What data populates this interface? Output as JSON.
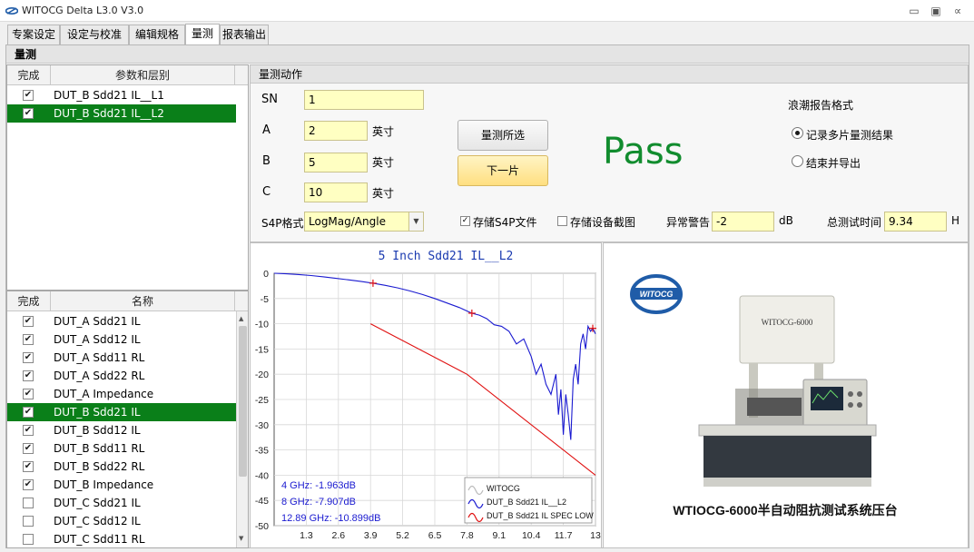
{
  "window": {
    "title": "WITOCG Delta L3.0 V3.0"
  },
  "tabs": [
    {
      "label": "专案设定"
    },
    {
      "label": "设定与校准"
    },
    {
      "label": "编辑规格"
    },
    {
      "label": "量测"
    },
    {
      "label": "报表输出"
    }
  ],
  "section_title": "量测",
  "layer_grid": {
    "headers": {
      "done": "完成",
      "param": "参数和层别"
    },
    "rows": [
      {
        "label": "DUT_B Sdd21 IL__L1",
        "checked": true,
        "selected": false
      },
      {
        "label": "DUT_B Sdd21 IL__L2",
        "checked": true,
        "selected": true
      }
    ]
  },
  "name_grid": {
    "headers": {
      "done": "完成",
      "name": "名称"
    },
    "rows": [
      {
        "label": "DUT_A Sdd21 IL",
        "checked": true,
        "selected": false
      },
      {
        "label": "DUT_A Sdd12 IL",
        "checked": true,
        "selected": false
      },
      {
        "label": "DUT_A Sdd11 RL",
        "checked": true,
        "selected": false
      },
      {
        "label": "DUT_A Sdd22 RL",
        "checked": true,
        "selected": false
      },
      {
        "label": "DUT_A Impedance",
        "checked": true,
        "selected": false
      },
      {
        "label": "DUT_B Sdd21 IL",
        "checked": true,
        "selected": true
      },
      {
        "label": "DUT_B Sdd12 IL",
        "checked": true,
        "selected": false
      },
      {
        "label": "DUT_B Sdd11 RL",
        "checked": true,
        "selected": false
      },
      {
        "label": "DUT_B Sdd22 RL",
        "checked": true,
        "selected": false
      },
      {
        "label": "DUT_B Impedance",
        "checked": true,
        "selected": false
      },
      {
        "label": "DUT_C Sdd21 IL",
        "checked": false,
        "selected": false
      },
      {
        "label": "DUT_C Sdd12 IL",
        "checked": false,
        "selected": false
      },
      {
        "label": "DUT_C Sdd11 RL",
        "checked": false,
        "selected": false
      }
    ]
  },
  "measure": {
    "title": "量测动作",
    "sn_label": "SN",
    "sn_value": "1",
    "a_label": "A",
    "a_value": "2",
    "b_label": "B",
    "b_value": "5",
    "c_label": "C",
    "c_value": "10",
    "unit_inch": "英寸",
    "s4p_format_label": "S4P格式",
    "s4p_format_value": "LogMag/Angle",
    "measure_selected_btn": "量测所选",
    "next_btn": "下一片",
    "result": "Pass",
    "result_color": "#118c2e",
    "save_s4p_label": "存储S4P文件",
    "save_s4p_checked": true,
    "save_screenshot_label": "存储设备截图",
    "save_screenshot_checked": false,
    "alarm_label": "异常警告",
    "alarm_value": "-2",
    "alarm_unit": "dB",
    "total_time_label": "总测试时间",
    "total_time_value": "9.34",
    "total_time_unit": "H",
    "report_format_label": "浪潮报告格式",
    "radio_record_multi": "记录多片量测结果",
    "radio_finish_export": "结束并导出",
    "radio_selected": "record_multi"
  },
  "photo": {
    "caption": "WTIOCG-6000半自动阻抗测试系统压台",
    "logo_text": "WITOCG",
    "machine_label": "WITOCG-6000"
  },
  "chart_data": {
    "type": "line",
    "title": "5 Inch Sdd21 IL__L2",
    "xlim": [
      0,
      13
    ],
    "ylim": [
      -50,
      0
    ],
    "x_ticks": [
      "1.3",
      "2.6",
      "3.9",
      "5.2",
      "6.5",
      "7.8",
      "9.1",
      "10.4",
      "11.7",
      "13"
    ],
    "y_ticks": [
      "0",
      "-5",
      "-10",
      "-15",
      "-20",
      "-25",
      "-30",
      "-35",
      "-40",
      "-45",
      "-50"
    ],
    "grid": true,
    "legend_position": "bottom-right",
    "legend": [
      "WITOCG",
      "DUT_B Sdd21 IL__L2",
      "DUT_B Sdd21 IL SPEC LOW"
    ],
    "annotations": [
      "4 GHz: -1.963dB",
      "8 GHz: -7.907dB",
      "12.89 GHz: -10.899dB"
    ],
    "series": [
      {
        "name": "DUT_B Sdd21 IL__L2",
        "color": "#1a1ad0",
        "x": [
          0,
          0.5,
          1.0,
          1.5,
          2.0,
          2.5,
          3.0,
          3.5,
          4.0,
          4.5,
          5.0,
          5.5,
          6.0,
          6.5,
          7.0,
          7.5,
          8.0,
          8.3,
          8.6,
          8.9,
          9.2,
          9.5,
          9.8,
          10.1,
          10.4,
          10.6,
          10.8,
          11.0,
          11.2,
          11.4,
          11.5,
          11.6,
          11.7,
          11.8,
          11.9,
          12.0,
          12.1,
          12.2,
          12.3,
          12.4,
          12.5,
          12.6,
          12.7,
          12.8,
          12.89,
          13.0
        ],
        "y": [
          0,
          -0.1,
          -0.25,
          -0.45,
          -0.7,
          -1.0,
          -1.3,
          -1.6,
          -1.963,
          -2.4,
          -2.9,
          -3.5,
          -4.2,
          -5.0,
          -5.9,
          -6.8,
          -7.907,
          -8.3,
          -9.0,
          -10.2,
          -10.5,
          -11.5,
          -14.0,
          -13.0,
          -16.5,
          -20.0,
          -18.0,
          -22.0,
          -24.0,
          -20.0,
          -28.0,
          -23.0,
          -32.0,
          -24.0,
          -28.0,
          -33.0,
          -21.0,
          -18.0,
          -22.0,
          -14.0,
          -12.0,
          -15.0,
          -10.5,
          -11.5,
          -10.899,
          -12.0
        ]
      },
      {
        "name": "DUT_B Sdd21 IL SPEC LOW",
        "color": "#e01010",
        "x": [
          3.9,
          7.8,
          13.0
        ],
        "y": [
          -10,
          -20,
          -40
        ]
      }
    ],
    "markers": [
      {
        "x": 4.0,
        "y": -1.963
      },
      {
        "x": 8.0,
        "y": -7.907
      },
      {
        "x": 12.89,
        "y": -10.899
      }
    ]
  }
}
